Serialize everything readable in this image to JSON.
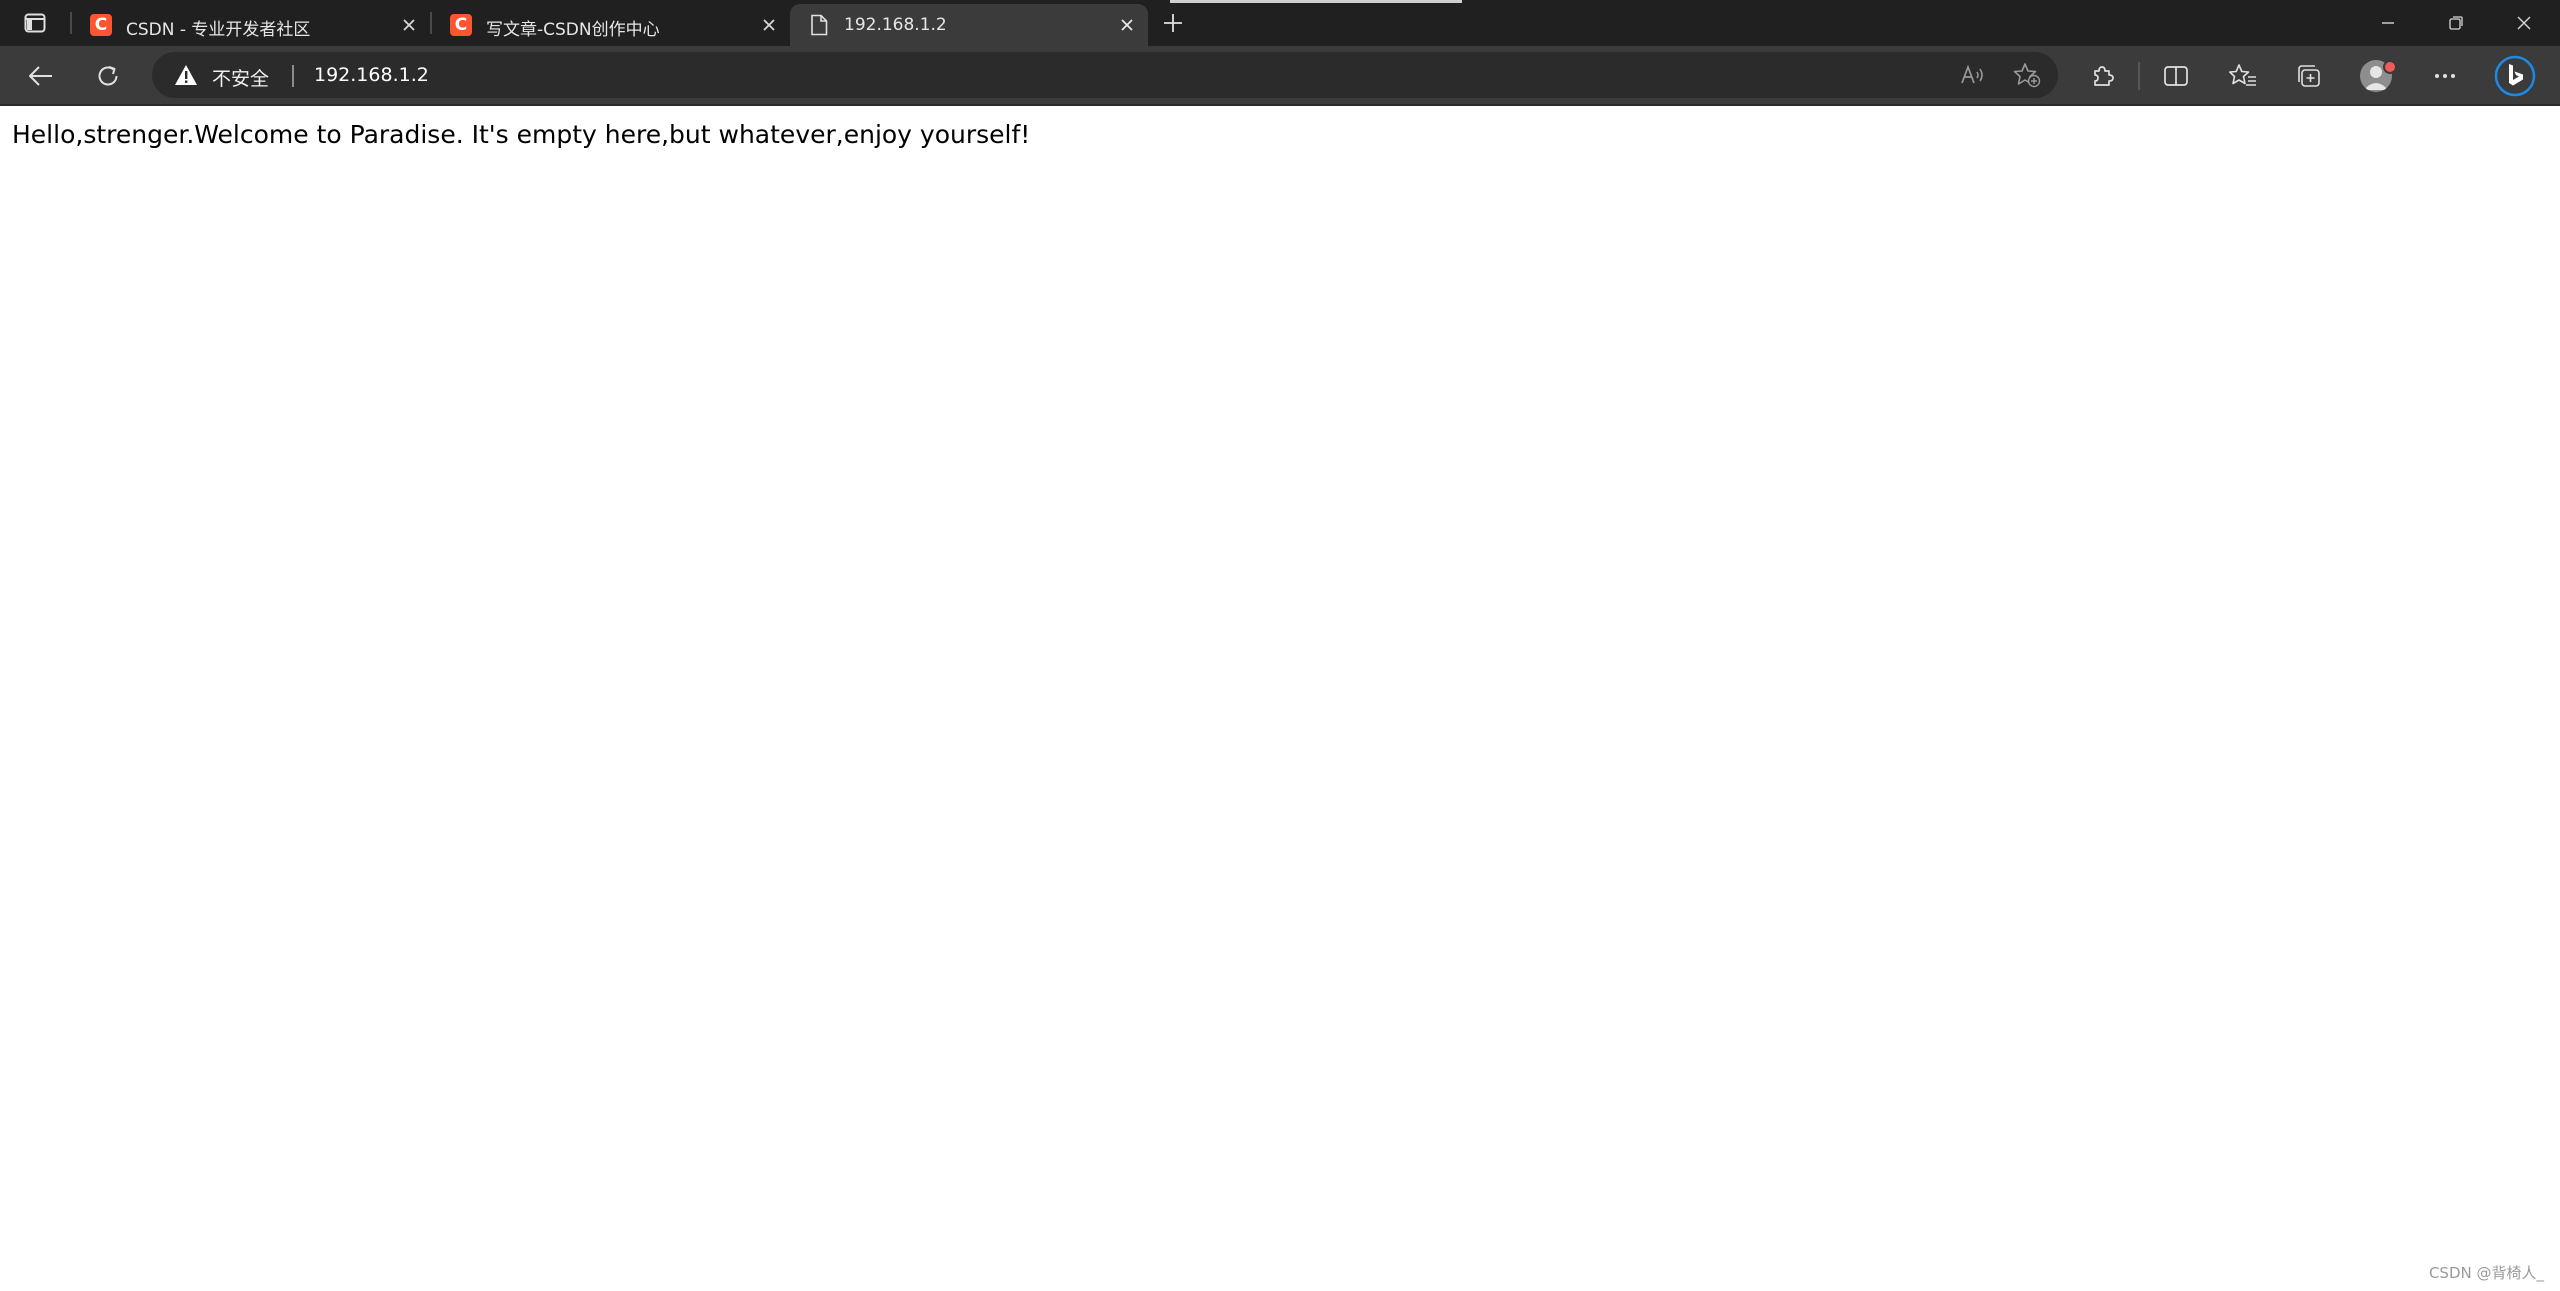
{
  "tabs": [
    {
      "title": "CSDN - 专业开发者社区",
      "favicon": "csdn-c-icon",
      "favicon_letter": "C",
      "active": false
    },
    {
      "title": "写文章-CSDN创作中心",
      "favicon": "csdn-c-icon",
      "favicon_letter": "C",
      "active": false
    },
    {
      "title": "192.168.1.2",
      "favicon": "page-icon",
      "active": true
    }
  ],
  "address_bar": {
    "security_label": "不安全",
    "url": "192.168.1.2"
  },
  "page": {
    "message": "Hello,strenger.Welcome to Paradise. It's empty here,but whatever,enjoy yourself!"
  },
  "watermark": "CSDN @背椅人_",
  "colors": {
    "tabstrip_bg": "#202020",
    "toolbar_bg": "#3b3b3b",
    "omnibox_bg": "#2b2b2b",
    "csdn_brand": "#fc5531",
    "bing_blue": "#1e88e5",
    "page_bg": "#ffffff"
  }
}
